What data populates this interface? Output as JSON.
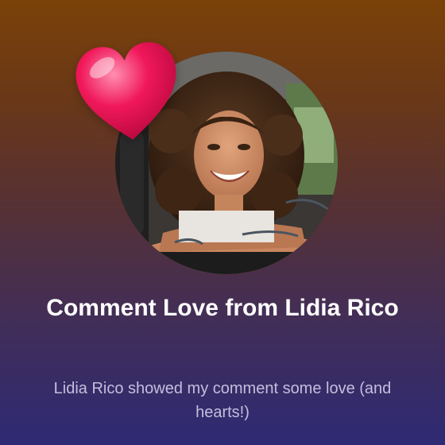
{
  "card": {
    "title": "Comment Love from Lidia Rico",
    "subtitle": "Lidia Rico showed my comment some love (and hearts!)"
  },
  "avatar": {
    "icon": "profile-photo"
  },
  "reaction": {
    "icon": "heart-icon",
    "color": "#f0185a"
  },
  "theme": {
    "gradient_top": "#7a4108",
    "gradient_bottom": "#2e2a74",
    "title_color": "#ffffff",
    "subtitle_color": "#c4bedc"
  }
}
